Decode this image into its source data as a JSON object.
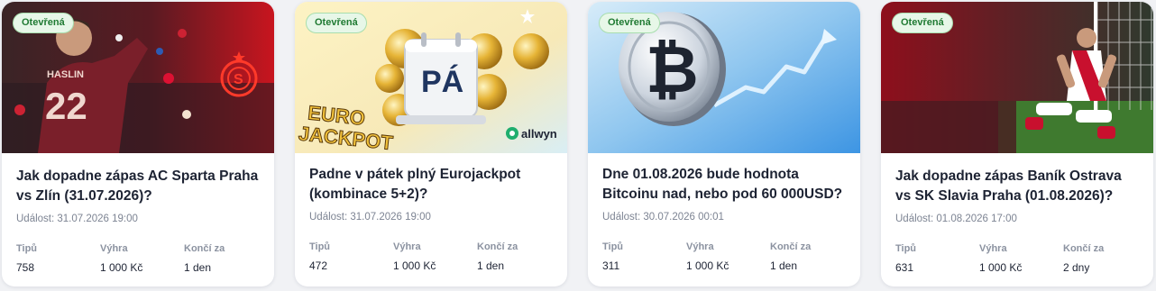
{
  "cards": [
    {
      "badge": "Otevřená",
      "title": "Jak dopadne zápas AC Sparta Praha vs Zlín (31.07.2026)?",
      "event": "Událost: 31.07.2026 19:00",
      "stats": [
        {
          "label": "Tipů",
          "value": "758"
        },
        {
          "label": "Výhra",
          "value": "1 000 Kč"
        },
        {
          "label": "Končí za",
          "value": "1 den"
        }
      ],
      "jersey_name": "HASLIN",
      "jersey_number": "22",
      "accent_color": "#d41d2c"
    },
    {
      "badge": "Otevřená",
      "title": "Padne v pátek plný Eurojackpot (kombinace 5+2)?",
      "event": "Událost: 31.07.2026 19:00",
      "stats": [
        {
          "label": "Tipů",
          "value": "472"
        },
        {
          "label": "Výhra",
          "value": "1 000 Kč"
        },
        {
          "label": "Končí za",
          "value": "1 den"
        }
      ],
      "calendar_text": "PÁ",
      "logo_line1": "EURO",
      "logo_line2": "JACKPOT",
      "brand": "allwyn",
      "accent_color": "#e8b42a"
    },
    {
      "badge": "Otevřená",
      "title": "Dne 01.08.2026 bude hodnota Bitcoinu nad, nebo pod 60 000USD?",
      "event": "Událost: 30.07.2026 00:01",
      "stats": [
        {
          "label": "Tipů",
          "value": "311"
        },
        {
          "label": "Výhra",
          "value": "1 000 Kč"
        },
        {
          "label": "Končí za",
          "value": "1 den"
        }
      ],
      "coin_symbol": "₿",
      "accent_color": "#3c8ee8"
    },
    {
      "badge": "Otevřená",
      "title": "Jak dopadne zápas Baník Ostrava vs SK Slavia Praha (01.08.2026)?",
      "event": "Událost: 01.08.2026 17:00",
      "stats": [
        {
          "label": "Tipů",
          "value": "631"
        },
        {
          "label": "Výhra",
          "value": "1 000 Kč"
        },
        {
          "label": "Končí za",
          "value": "2 dny"
        }
      ],
      "accent_color": "#c8102e"
    }
  ]
}
